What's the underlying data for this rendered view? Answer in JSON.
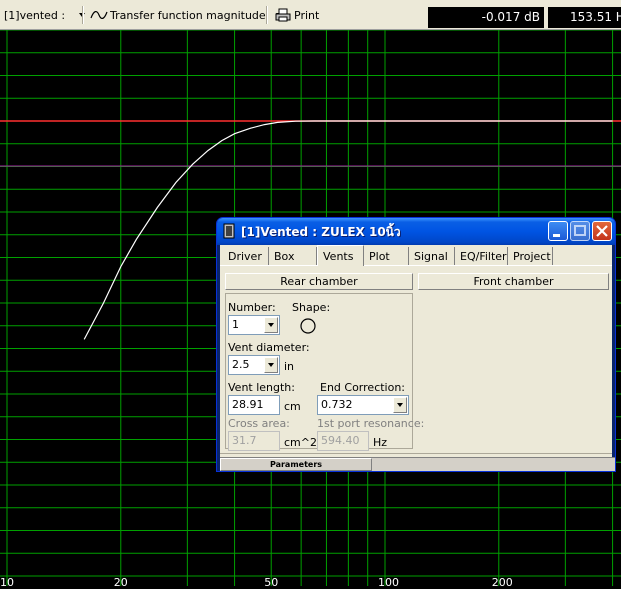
{
  "toolbar": {
    "mode_label": "[1]vented :",
    "view_label": "Transfer function magnitude",
    "print_label": "Print",
    "readout_db": "-0.017 dB",
    "readout_hz": "153.51 H"
  },
  "plot": {
    "x_tick_labels": [
      "10",
      "20",
      "50",
      "100",
      "200"
    ],
    "colors": {
      "grid": "#00a000",
      "reference": "#ff3030",
      "curve": "#ffffff",
      "secondary": "#a020a0"
    }
  },
  "chart_data": {
    "type": "line",
    "x_scale": "log",
    "xlim": [
      10,
      400
    ],
    "x_ticks": [
      10,
      20,
      50,
      100,
      200
    ],
    "series": [
      {
        "x": [
          16,
          18,
          20,
          22,
          25,
          28,
          31,
          34,
          37,
          40,
          44,
          48,
          52,
          58,
          65,
          80,
          100,
          150,
          200,
          300,
          400
        ],
        "y": [
          -48,
          -40,
          -32,
          -26,
          -19,
          -13.5,
          -9.5,
          -6.5,
          -4.3,
          -2.8,
          -1.6,
          -0.8,
          -0.3,
          -0.05,
          0,
          0,
          0,
          0,
          0,
          0,
          0
        ]
      }
    ],
    "ylim": [
      -50,
      10
    ],
    "reference_line_y": 0
  },
  "window": {
    "title": "[1]Vented : ZULEX 10นิ้ว",
    "tabs": [
      "Driver",
      "Box",
      "Vents",
      "Plot",
      "Signal",
      "EQ/Filter",
      "Project"
    ],
    "active_tab": "Vents",
    "rear_chamber_label": "Rear chamber",
    "front_chamber_label": "Front chamber",
    "number_label": "Number:",
    "number_value": "1",
    "shape_label": "Shape:",
    "vent_diameter_label": "Vent diameter:",
    "vent_diameter_value": "2.5",
    "vent_diameter_unit": "in",
    "vent_length_label": "Vent length:",
    "vent_length_value": "28.91",
    "vent_length_unit": "cm",
    "end_correction_label": "End Correction:",
    "end_correction_value": "0.732",
    "cross_area_label": "Cross area:",
    "cross_area_value": "31.7",
    "cross_area_unit": "cm^2",
    "port_resonance_label": "1st port resonance:",
    "port_resonance_value": "594.40",
    "port_resonance_unit": "Hz",
    "status_label": "Parameters"
  }
}
